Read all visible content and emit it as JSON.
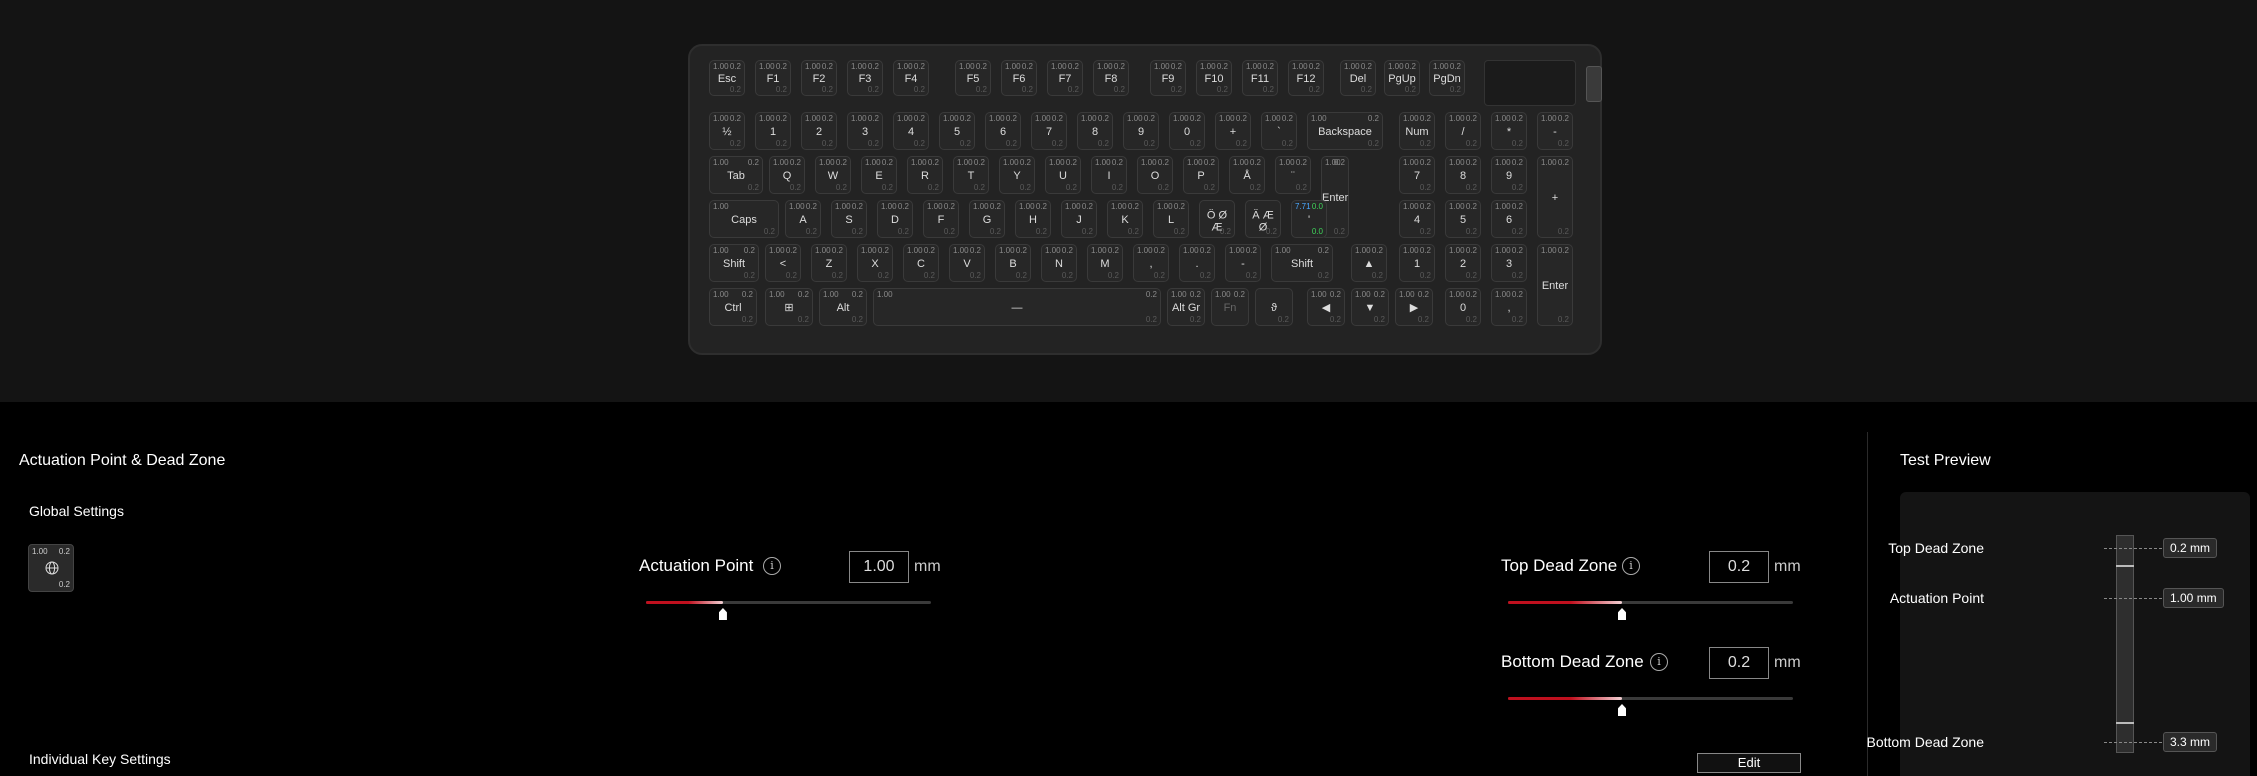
{
  "keyboard": {
    "rows": [
      [
        {
          "label": "Esc",
          "act": "1.00",
          "dz": "0.2",
          "bdz": "0.2"
        },
        {
          "label": "F1",
          "act": "1.00",
          "dz": "0.2",
          "bdz": "0.2"
        },
        {
          "label": "F2",
          "act": "1.00",
          "dz": "0.2",
          "bdz": "0.2"
        },
        {
          "label": "F3",
          "act": "1.00",
          "dz": "0.2",
          "bdz": "0.2"
        },
        {
          "label": "F4",
          "act": "1.00",
          "dz": "0.2",
          "bdz": "0.2"
        },
        {
          "label": "F5",
          "act": "1.00",
          "dz": "0.2",
          "bdz": "0.2"
        },
        {
          "label": "F6",
          "act": "1.00",
          "dz": "0.2",
          "bdz": "0.2"
        },
        {
          "label": "F7",
          "act": "1.00",
          "dz": "0.2",
          "bdz": "0.2"
        },
        {
          "label": "F8",
          "act": "1.00",
          "dz": "0.2",
          "bdz": "0.2"
        },
        {
          "label": "F9",
          "act": "1.00",
          "dz": "0.2",
          "bdz": "0.2"
        },
        {
          "label": "F10",
          "act": "1.00",
          "dz": "0.2",
          "bdz": "0.2"
        },
        {
          "label": "F11",
          "act": "1.00",
          "dz": "0.2",
          "bdz": "0.2"
        },
        {
          "label": "F12",
          "act": "1.00",
          "dz": "0.2",
          "bdz": "0.2"
        },
        {
          "label": "Del",
          "act": "1.00",
          "dz": "0.2",
          "bdz": "0.2"
        },
        {
          "label": "PgUp",
          "act": "1.00",
          "dz": "0.2",
          "bdz": "0.2"
        },
        {
          "label": "PgDn",
          "act": "1.00",
          "dz": "0.2",
          "bdz": "0.2"
        }
      ],
      [
        {
          "label": "½",
          "act": "1.00",
          "dz": "0.2",
          "bdz": "0.2"
        },
        {
          "label": "1",
          "act": "1.00",
          "dz": "0.2",
          "bdz": "0.2"
        },
        {
          "label": "2",
          "act": "1.00",
          "dz": "0.2",
          "bdz": "0.2"
        },
        {
          "label": "3",
          "act": "1.00",
          "dz": "0.2",
          "bdz": "0.2"
        },
        {
          "label": "4",
          "act": "1.00",
          "dz": "0.2",
          "bdz": "0.2"
        },
        {
          "label": "5",
          "act": "1.00",
          "dz": "0.2",
          "bdz": "0.2"
        },
        {
          "label": "6",
          "act": "1.00",
          "dz": "0.2",
          "bdz": "0.2"
        },
        {
          "label": "7",
          "act": "1.00",
          "dz": "0.2",
          "bdz": "0.2"
        },
        {
          "label": "8",
          "act": "1.00",
          "dz": "0.2",
          "bdz": "0.2"
        },
        {
          "label": "9",
          "act": "1.00",
          "dz": "0.2",
          "bdz": "0.2"
        },
        {
          "label": "0",
          "act": "1.00",
          "dz": "0.2",
          "bdz": "0.2"
        },
        {
          "label": "+",
          "act": "1.00",
          "dz": "0.2",
          "bdz": "0.2"
        },
        {
          "label": "`",
          "act": "1.00",
          "dz": "0.2",
          "bdz": "0.2"
        },
        {
          "label": "Backspace",
          "act": "1.00",
          "dz": "0.2",
          "bdz": "0.2"
        },
        {
          "label": "Num",
          "act": "1.00",
          "dz": "0.2",
          "bdz": "0.2"
        },
        {
          "label": "/",
          "act": "1.00",
          "dz": "0.2",
          "bdz": "0.2"
        },
        {
          "label": "*",
          "act": "1.00",
          "dz": "0.2",
          "bdz": "0.2"
        },
        {
          "label": "-",
          "act": "1.00",
          "dz": "0.2",
          "bdz": "0.2"
        }
      ],
      [
        {
          "label": "Tab",
          "act": "1.00",
          "dz": "0.2",
          "bdz": "0.2"
        },
        {
          "label": "Q",
          "act": "1.00",
          "dz": "0.2",
          "bdz": "0.2"
        },
        {
          "label": "W",
          "act": "1.00",
          "dz": "0.2",
          "bdz": "0.2"
        },
        {
          "label": "E",
          "act": "1.00",
          "dz": "0.2",
          "bdz": "0.2"
        },
        {
          "label": "R",
          "act": "1.00",
          "dz": "0.2",
          "bdz": "0.2"
        },
        {
          "label": "T",
          "act": "1.00",
          "dz": "0.2",
          "bdz": "0.2"
        },
        {
          "label": "Y",
          "act": "1.00",
          "dz": "0.2",
          "bdz": "0.2"
        },
        {
          "label": "U",
          "act": "1.00",
          "dz": "0.2",
          "bdz": "0.2"
        },
        {
          "label": "I",
          "act": "1.00",
          "dz": "0.2",
          "bdz": "0.2"
        },
        {
          "label": "O",
          "act": "1.00",
          "dz": "0.2",
          "bdz": "0.2"
        },
        {
          "label": "P",
          "act": "1.00",
          "dz": "0.2",
          "bdz": "0.2"
        },
        {
          "label": "Å",
          "act": "1.00",
          "dz": "0.2",
          "bdz": "0.2"
        },
        {
          "label": "¨",
          "act": "1.00",
          "dz": "0.2",
          "bdz": "0.2"
        },
        {
          "label": "Enter",
          "act": "1.00",
          "dz": "0.2",
          "bdz": "0.2"
        },
        {
          "label": "7",
          "act": "1.00",
          "dz": "0.2",
          "bdz": "0.2"
        },
        {
          "label": "8",
          "act": "1.00",
          "dz": "0.2",
          "bdz": "0.2"
        },
        {
          "label": "9",
          "act": "1.00",
          "dz": "0.2",
          "bdz": "0.2"
        },
        {
          "label": "+",
          "act": "1.00",
          "dz": "0.2",
          "bdz": "0.2"
        }
      ],
      [
        {
          "label": "Caps",
          "act": "1.00",
          "dz": "",
          "bdz": "0.2"
        },
        {
          "label": "A",
          "act": "1.00",
          "dz": "0.2",
          "bdz": "0.2"
        },
        {
          "label": "S",
          "act": "1.00",
          "dz": "0.2",
          "bdz": "0.2"
        },
        {
          "label": "D",
          "act": "1.00",
          "dz": "0.2",
          "bdz": "0.2"
        },
        {
          "label": "F",
          "act": "1.00",
          "dz": "0.2",
          "bdz": "0.2"
        },
        {
          "label": "G",
          "act": "1.00",
          "dz": "0.2",
          "bdz": "0.2"
        },
        {
          "label": "H",
          "act": "1.00",
          "dz": "0.2",
          "bdz": "0.2"
        },
        {
          "label": "J",
          "act": "1.00",
          "dz": "0.2",
          "bdz": "0.2"
        },
        {
          "label": "K",
          "act": "1.00",
          "dz": "0.2",
          "bdz": "0.2"
        },
        {
          "label": "L",
          "act": "1.00",
          "dz": "0.2",
          "bdz": "0.2"
        },
        {
          "label": "Ö Ø\nÆ",
          "act": "",
          "dz": "",
          "bdz": "0.2"
        },
        {
          "label": "Ä Æ\nØ",
          "act": "",
          "dz": "",
          "bdz": "0.2"
        },
        {
          "label": "'",
          "act": "7.71",
          "dz": "0.0",
          "bdz": "0.0"
        },
        {
          "label": "4",
          "act": "1.00",
          "dz": "0.2",
          "bdz": "0.2"
        },
        {
          "label": "5",
          "act": "1.00",
          "dz": "0.2",
          "bdz": "0.2"
        },
        {
          "label": "6",
          "act": "1.00",
          "dz": "0.2",
          "bdz": "0.2"
        }
      ],
      [
        {
          "label": "Shift",
          "act": "1.00",
          "dz": "0.2",
          "bdz": "0.2"
        },
        {
          "label": "<",
          "act": "1.00",
          "dz": "0.2",
          "bdz": "0.2"
        },
        {
          "label": "Z",
          "act": "1.00",
          "dz": "0.2",
          "bdz": "0.2"
        },
        {
          "label": "X",
          "act": "1.00",
          "dz": "0.2",
          "bdz": "0.2"
        },
        {
          "label": "C",
          "act": "1.00",
          "dz": "0.2",
          "bdz": "0.2"
        },
        {
          "label": "V",
          "act": "1.00",
          "dz": "0.2",
          "bdz": "0.2"
        },
        {
          "label": "B",
          "act": "1.00",
          "dz": "0.2",
          "bdz": "0.2"
        },
        {
          "label": "N",
          "act": "1.00",
          "dz": "0.2",
          "bdz": "0.2"
        },
        {
          "label": "M",
          "act": "1.00",
          "dz": "0.2",
          "bdz": "0.2"
        },
        {
          "label": ",",
          "act": "1.00",
          "dz": "0.2",
          "bdz": "0.2"
        },
        {
          "label": ".",
          "act": "1.00",
          "dz": "0.2",
          "bdz": "0.2"
        },
        {
          "label": "-",
          "act": "1.00",
          "dz": "0.2",
          "bdz": "0.2"
        },
        {
          "label": "Shift",
          "act": "1.00",
          "dz": "0.2",
          "bdz": "0.2"
        },
        {
          "label": "▲",
          "act": "1.00",
          "dz": "0.2",
          "bdz": "0.2"
        },
        {
          "label": "1",
          "act": "1.00",
          "dz": "0.2",
          "bdz": "0.2"
        },
        {
          "label": "2",
          "act": "1.00",
          "dz": "0.2",
          "bdz": "0.2"
        },
        {
          "label": "3",
          "act": "1.00",
          "dz": "0.2",
          "bdz": "0.2"
        },
        {
          "label": "Enter",
          "act": "1.00",
          "dz": "0.2",
          "bdz": "0.2"
        }
      ],
      [
        {
          "label": "Ctrl",
          "act": "1.00",
          "dz": "0.2",
          "bdz": "0.2"
        },
        {
          "label": "⊞",
          "act": "1.00",
          "dz": "0.2",
          "bdz": "0.2"
        },
        {
          "label": "Alt",
          "act": "1.00",
          "dz": "0.2",
          "bdz": "0.2"
        },
        {
          "label": "—",
          "act": "1.00",
          "dz": "0.2",
          "bdz": "0.2"
        },
        {
          "label": "Alt Gr",
          "act": "1.00",
          "dz": "0.2",
          "bdz": "0.2"
        },
        {
          "label": "Fn",
          "act": "1.00",
          "dz": "0.2",
          "bdz": ""
        },
        {
          "label": "ϑ",
          "act": "",
          "dz": "",
          "bdz": "0.2"
        },
        {
          "label": "◀",
          "act": "1.00",
          "dz": "0.2",
          "bdz": "0.2"
        },
        {
          "label": "▼",
          "act": "1.00",
          "dz": "0.2",
          "bdz": "0.2"
        },
        {
          "label": "▶",
          "act": "1.00",
          "dz": "0.2",
          "bdz": "0.2"
        },
        {
          "label": "0",
          "act": "1.00",
          "dz": "0.2",
          "bdz": "0.2"
        },
        {
          "label": ",",
          "act": "1.00",
          "dz": "0.2",
          "bdz": "0.2"
        }
      ]
    ]
  },
  "settings": {
    "title": "Actuation Point & Dead Zone",
    "global_label": "Global Settings",
    "global_key": {
      "act": "1.00",
      "dz": "0.2",
      "bdz": "0.2"
    },
    "individual_label": "Individual Key Settings",
    "actuation": {
      "label": "Actuation Point",
      "value": "1.00",
      "unit": "mm",
      "info": "i",
      "slider_fraction": 0.27
    },
    "top_dead_zone": {
      "label": "Top Dead Zone",
      "value": "0.2",
      "unit": "mm",
      "info": "i",
      "slider_fraction": 0.4
    },
    "bottom_dead_zone": {
      "label": "Bottom Dead Zone",
      "value": "0.2",
      "unit": "mm",
      "info": "i",
      "slider_fraction": 0.4
    },
    "edit_label": "Edit"
  },
  "preview": {
    "title": "Test Preview",
    "top_dead_zone": {
      "label": "Top Dead Zone",
      "value": "0.2 mm"
    },
    "actuation_point": {
      "label": "Actuation Point",
      "value": "1.00 mm"
    },
    "bottom_dead_zone": {
      "label": "Bottom Dead Zone",
      "value": "3.3 mm"
    }
  },
  "colors": {
    "accent": "#c0101e",
    "highlight_blue": "#4aa8ff",
    "highlight_green": "#3fd25a"
  }
}
